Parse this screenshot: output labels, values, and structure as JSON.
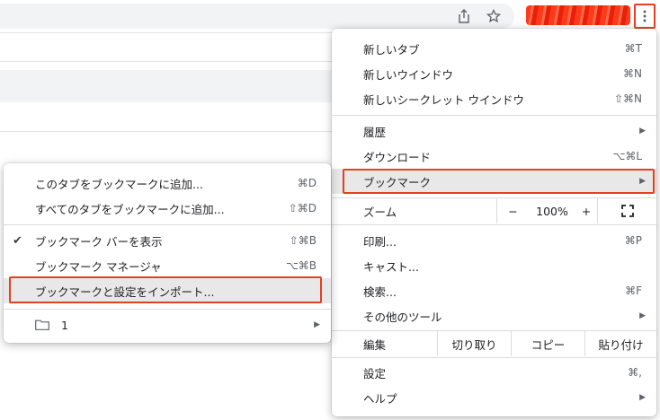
{
  "toolbar": {
    "icons": [
      "share-icon",
      "star-icon",
      "more-vert-icon"
    ]
  },
  "main_menu": {
    "new_tab": {
      "label": "新しいタブ",
      "shortcut": "⌘T"
    },
    "new_window": {
      "label": "新しいウインドウ",
      "shortcut": "⌘N"
    },
    "new_incognito": {
      "label": "新しいシークレット ウインドウ",
      "shortcut": "⇧⌘N"
    },
    "history": {
      "label": "履歴"
    },
    "downloads": {
      "label": "ダウンロード",
      "shortcut": "⌥⌘L"
    },
    "bookmarks": {
      "label": "ブックマーク"
    },
    "zoom": {
      "label": "ズーム",
      "minus": "−",
      "value": "100%",
      "plus": "+"
    },
    "print": {
      "label": "印刷...",
      "shortcut": "⌘P"
    },
    "cast": {
      "label": "キャスト..."
    },
    "find": {
      "label": "検索...",
      "shortcut": "⌘F"
    },
    "more_tools": {
      "label": "その他のツール"
    },
    "edit": {
      "label": "編集",
      "cut": "切り取り",
      "copy": "コピー",
      "paste": "貼り付け"
    },
    "settings": {
      "label": "設定",
      "shortcut": "⌘,"
    },
    "help": {
      "label": "ヘルプ"
    }
  },
  "bookmark_menu": {
    "add_tab": {
      "label": "このタブをブックマークに追加...",
      "shortcut": "⌘D"
    },
    "add_all": {
      "label": "すべてのタブをブックマークに追加...",
      "shortcut": "⇧⌘D"
    },
    "show_bar": {
      "label": "ブックマーク バーを表示",
      "shortcut": "⇧⌘B",
      "checked": true
    },
    "manager": {
      "label": "ブックマーク マネージャ",
      "shortcut": "⌥⌘B"
    },
    "import": {
      "label": "ブックマークと設定をインポート..."
    },
    "folder": {
      "label": "1"
    }
  },
  "colors": {
    "highlight_border": "#e8401e",
    "hover_bg": "#e8e8e8"
  }
}
